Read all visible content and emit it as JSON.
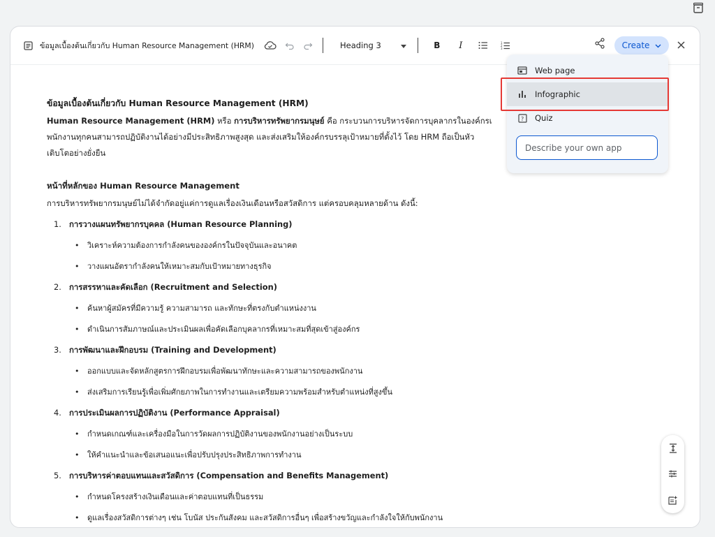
{
  "toolbar": {
    "doc_title": "ข้อมูลเบื้องต้นเกี่ยวกับ Human Resource Management (HRM)",
    "style_dropdown": "Heading 3",
    "bold_label": "B",
    "italic_label": "I",
    "create_label": "Create"
  },
  "document": {
    "heading": "ข้อมูลเบื้องต้นเกี่ยวกับ Human Resource Management (HRM)",
    "intro_line1_a": "Human Resource Management (HRM)",
    "intro_line1_b": " หรือ ",
    "intro_line1_c": "การบริหารทรัพยากรมนุษย์",
    "intro_line1_d": " คือ กระบวนการบริหารจัดการบุคลากรในองค์กรเ",
    "intro_line2": "พนักงานทุกคนสามารถปฏิบัติงานได้อย่างมีประสิทธิภาพสูงสุด และส่งเสริมให้องค์กรบรรลุเป้าหมายที่ตั้งไว้ โดย HRM ถือเป็นหัว",
    "intro_line3": "เติบโตอย่างยั่งยืน",
    "section_heading": "หน้าที่หลักของ Human Resource Management",
    "section_intro": "การบริหารทรัพยากรมนุษย์ไม่ได้จำกัดอยู่แค่การดูแลเรื่องเงินเดือนหรือสวัสดิการ แต่ครอบคลุมหลายด้าน ดังนี้:",
    "items": [
      {
        "num": "1.",
        "title": "การวางแผนทรัพยากรบุคคล (Human Resource Planning)",
        "bullets": [
          "วิเคราะห์ความต้องการกำลังคนขององค์กรในปัจจุบันและอนาคต",
          "วางแผนอัตรากำลังคนให้เหมาะสมกับเป้าหมายทางธุรกิจ"
        ]
      },
      {
        "num": "2.",
        "title": "การสรรหาและคัดเลือก (Recruitment and Selection)",
        "bullets": [
          "ค้นหาผู้สมัครที่มีความรู้ ความสามารถ และทักษะที่ตรงกับตำแหน่งงาน",
          "ดำเนินการสัมภาษณ์และประเมินผลเพื่อคัดเลือกบุคลากรที่เหมาะสมที่สุดเข้าสู่องค์กร"
        ]
      },
      {
        "num": "3.",
        "title": "การพัฒนาและฝึกอบรม (Training and Development)",
        "bullets": [
          "ออกแบบและจัดหลักสูตรการฝึกอบรมเพื่อพัฒนาทักษะและความสามารถของพนักงาน",
          "ส่งเสริมการเรียนรู้เพื่อเพิ่มศักยภาพในการทำงานและเตรียมความพร้อมสำหรับตำแหน่งที่สูงขึ้น"
        ]
      },
      {
        "num": "4.",
        "title": "การประเมินผลการปฏิบัติงาน (Performance Appraisal)",
        "bullets": [
          "กำหนดเกณฑ์และเครื่องมือในการวัดผลการปฏิบัติงานของพนักงานอย่างเป็นระบบ",
          "ให้คำแนะนำและข้อเสนอแนะเพื่อปรับปรุงประสิทธิภาพการทำงาน"
        ]
      },
      {
        "num": "5.",
        "title": "การบริหารค่าตอบแทนและสวัสดิการ (Compensation and Benefits Management)",
        "bullets": [
          "กำหนดโครงสร้างเงินเดือนและค่าตอบแทนที่เป็นธรรม",
          "ดูแลเรื่องสวัสดิการต่างๆ เช่น โบนัส ประกันสังคม และสวัสดิการอื่นๆ เพื่อสร้างขวัญและกำลังใจให้กับพนักงาน"
        ]
      }
    ]
  },
  "create_menu": {
    "items": [
      {
        "label": "Web page",
        "icon": "web-page-icon"
      },
      {
        "label": "Infographic",
        "icon": "bar-chart-icon"
      },
      {
        "label": "Quiz",
        "icon": "quiz-icon"
      }
    ],
    "input_placeholder": "Describe your own app"
  },
  "colors": {
    "accent": "#0b57d0",
    "create_bg": "#d3e3fd",
    "highlight": "#e53935"
  }
}
